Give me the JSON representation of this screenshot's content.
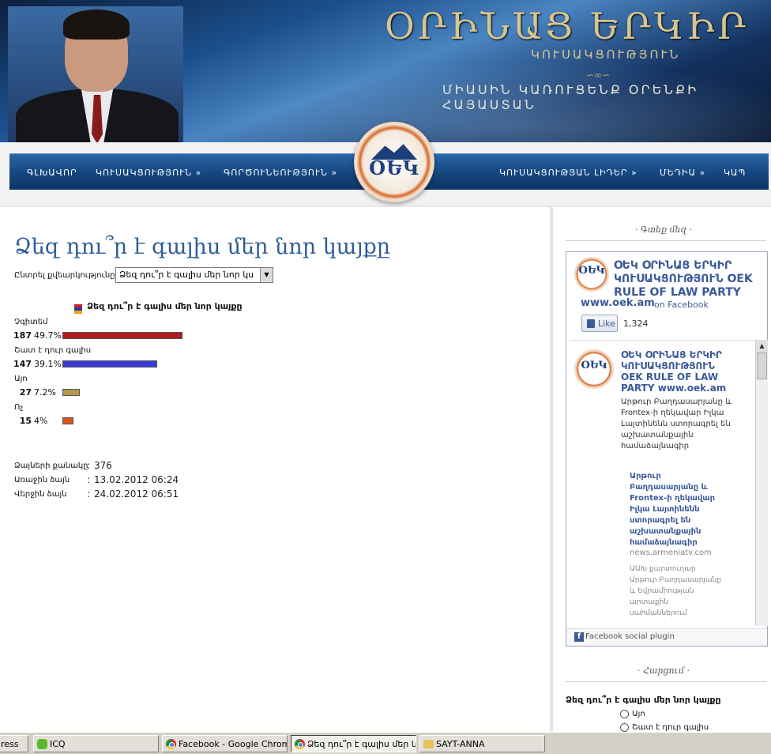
{
  "header": {
    "brand_title": "ՕՐԻՆԱՑ ԵՐԿԻՐ",
    "brand_subtitle": "ԿՈՒՍԱԿՑՈՒԹՅՈՒՆ",
    "ornament": "∽∞∽",
    "slogan": "ՄԻԱՍԻՆ ԿԱՌՈՒՑԵՆՔ ՕՐԵՆՔԻ ՀԱՅԱՍՏԱՆ"
  },
  "logo": {
    "letters": "ՕԵԿ"
  },
  "nav": {
    "items": [
      {
        "label": "ԳԼԽԱՎՈՐ"
      },
      {
        "label": "ԿՈՒՍԱԿՑՈՒԹՅՈՒՆ »"
      },
      {
        "label": "ԳՈՐԾՈՒՆԵՈՒԹՅՈՒՆ »"
      },
      {
        "label": "ԿՈՒՍԱԿՑՈՒԹՅԱՆ ԼԻԴԵՐ »"
      },
      {
        "label": "ՄԵԴԻԱ »"
      },
      {
        "label": "ԿԱՊ"
      }
    ]
  },
  "poll": {
    "title": "Ձեզ դու՞ր է գալիս մեր նոր կայքը",
    "select_label": "Ընտրել քվեարկությունը",
    "select_value": "Ձեզ դու՞ր է գալիս մեր նոր կս",
    "chart_heading": "Ձեզ դու՞ր է գալիս մեր նոր կայքը",
    "stats": [
      {
        "label": "Ձայների քանակը",
        "sep": ":",
        "value": "376"
      },
      {
        "label": "Առաջին ձայն",
        "sep": ":",
        "value": "13.02.2012 06:24"
      },
      {
        "label": "Վերջին ձայն",
        "sep": ":",
        "value": "24.02.2012 06:51"
      }
    ]
  },
  "chart_data": {
    "type": "bar",
    "title": "Ձեզ դու՞ր է գալիս մեր նոր կայքը",
    "categories": [
      "Չգիտեմ",
      "Շատ է դուր գալիս",
      "Այո",
      "Ոչ"
    ],
    "values": [
      187,
      147,
      27,
      15
    ],
    "percent_labels": [
      "49.7%",
      "39.1%",
      "7.2%",
      "4%"
    ],
    "colors": [
      "#b31b1b",
      "#3a3ad6",
      "#b49a4a",
      "#d9531f"
    ],
    "grid": false,
    "legend": "none"
  },
  "sidebar": {
    "follow_heading": "Գտեք մեզ",
    "fb": {
      "page_name": "ՕԵԿ ՕՐԻՆԱՑ ԵՐԿԻՐ ԿՈՒՍԱԿՑՈՒԹՅՈՒՆ OEK RULE OF LAW PARTY",
      "url": "www.oek.am",
      "on": "on Facebook",
      "like_label": "Like",
      "like_count": "1,324",
      "post_author": "ՕԵԿ ՕՐԻՆԱՑ ԵՐԿԻՐ ԿՈՒՍԱԿՑՈՒԹՅՈՒՆ OEK RULE OF LAW PARTY www.oek.am",
      "post_text": "Արթուր Բաղդասարյանը և Frontex-ի ղեկավար Իլկա Լայտինենն ստորագրել են աշխատանքային համաձայնագիր",
      "post_link": "Արթուր Բաղդասարյանը և Frontex-ի ղեկավար Իլկա Լայտինենն ստորագրել են աշխատանքային համաձայնագիր",
      "post_source": "news.armeniatv.com",
      "post_excerpt": "ԱԱԽ քարտուղար Արթուր Բաղդասարյանը և Եվրամիության արտաքին սահմաններում",
      "footer": "Facebook social plugin"
    },
    "poll_heading": "Հարցում",
    "poll_question": "Ձեզ դու՞ր է գալիս մեր նոր կայքը",
    "poll_options": [
      {
        "label": "Այո"
      },
      {
        "label": "Շատ է դուր գալիս"
      }
    ]
  },
  "taskbar": {
    "items": [
      {
        "label": "ress",
        "icon": "none"
      },
      {
        "label": "ICQ",
        "icon": "icq-icon"
      },
      {
        "label": "Facebook - Google Chrome",
        "icon": "chrome-icon"
      },
      {
        "label": "Ձեզ դու՞ր է գալիս մեր կ...",
        "icon": "chrome-icon",
        "active": true
      },
      {
        "label": "SAYT-ANNA",
        "icon": "folder-icon"
      }
    ]
  }
}
